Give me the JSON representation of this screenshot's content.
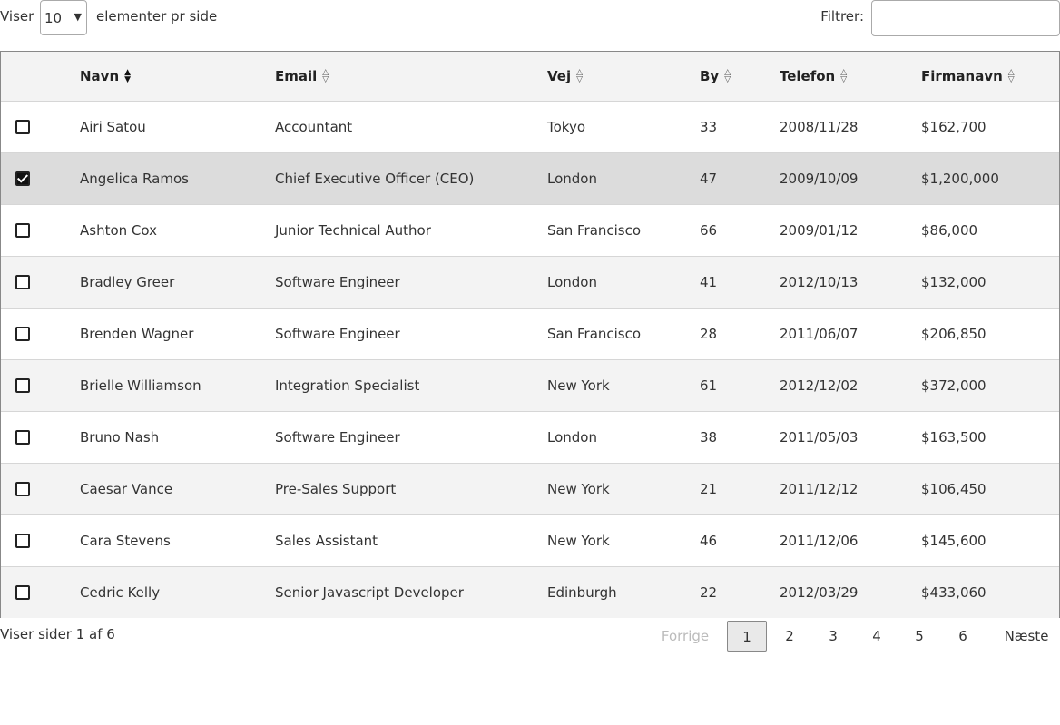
{
  "length_control": {
    "prefix": "Viser",
    "selected": "10",
    "suffix": "elementer pr side"
  },
  "filter": {
    "label": "Filtrer:",
    "value": ""
  },
  "table": {
    "columns": [
      "Navn",
      "Email",
      "Vej",
      "By",
      "Telefon",
      "Firmanavn"
    ],
    "sorted_column": "Navn",
    "rows": [
      {
        "checked": false,
        "cells": [
          "Airi Satou",
          "Accountant",
          "Tokyo",
          "33",
          "2008/11/28",
          "$162,700"
        ]
      },
      {
        "checked": true,
        "cells": [
          "Angelica Ramos",
          "Chief Executive Officer (CEO)",
          "London",
          "47",
          "2009/10/09",
          "$1,200,000"
        ]
      },
      {
        "checked": false,
        "cells": [
          "Ashton Cox",
          "Junior Technical Author",
          "San Francisco",
          "66",
          "2009/01/12",
          "$86,000"
        ]
      },
      {
        "checked": false,
        "cells": [
          "Bradley Greer",
          "Software Engineer",
          "London",
          "41",
          "2012/10/13",
          "$132,000"
        ]
      },
      {
        "checked": false,
        "cells": [
          "Brenden Wagner",
          "Software Engineer",
          "San Francisco",
          "28",
          "2011/06/07",
          "$206,850"
        ]
      },
      {
        "checked": false,
        "cells": [
          "Brielle Williamson",
          "Integration Specialist",
          "New York",
          "61",
          "2012/12/02",
          "$372,000"
        ]
      },
      {
        "checked": false,
        "cells": [
          "Bruno Nash",
          "Software Engineer",
          "London",
          "38",
          "2011/05/03",
          "$163,500"
        ]
      },
      {
        "checked": false,
        "cells": [
          "Caesar Vance",
          "Pre-Sales Support",
          "New York",
          "21",
          "2011/12/12",
          "$106,450"
        ]
      },
      {
        "checked": false,
        "cells": [
          "Cara Stevens",
          "Sales Assistant",
          "New York",
          "46",
          "2011/12/06",
          "$145,600"
        ]
      },
      {
        "checked": false,
        "cells": [
          "Cedric Kelly",
          "Senior Javascript Developer",
          "Edinburgh",
          "22",
          "2012/03/29",
          "$433,060"
        ]
      }
    ]
  },
  "info": "Viser sider 1 af 6",
  "pagination": {
    "previous": "Forrige",
    "pages": [
      "1",
      "2",
      "3",
      "4",
      "5",
      "6"
    ],
    "current": "1",
    "next": "Næste"
  },
  "icons": {
    "sort_active": "sort-asc-icon",
    "sort_inactive": "sort-both-icon",
    "select_chevron": "chevron-down-icon",
    "checkbox": "checkbox-icon"
  }
}
